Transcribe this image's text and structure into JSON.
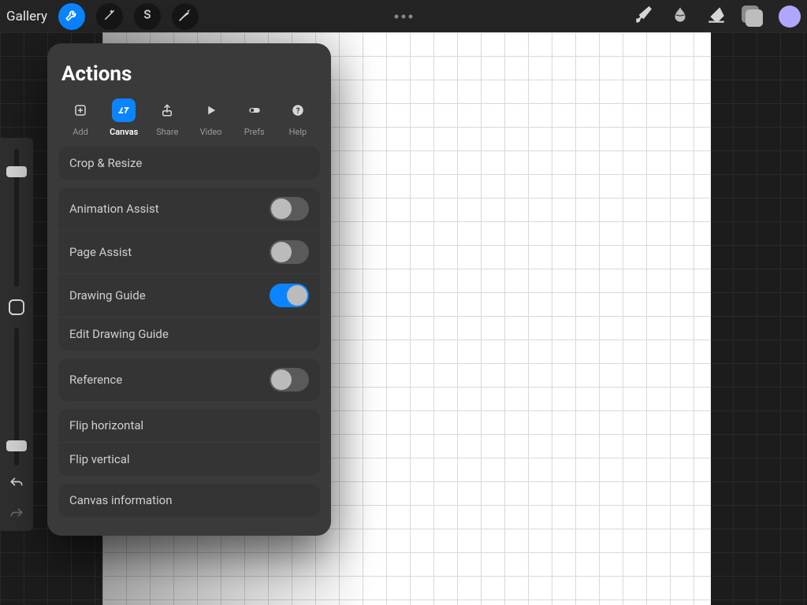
{
  "topbar": {
    "gallery": "Gallery"
  },
  "popover": {
    "title": "Actions",
    "tabs": [
      {
        "label": "Add"
      },
      {
        "label": "Canvas"
      },
      {
        "label": "Share"
      },
      {
        "label": "Video"
      },
      {
        "label": "Prefs"
      },
      {
        "label": "Help"
      }
    ],
    "crop_resize": "Crop & Resize",
    "animation_assist": "Animation Assist",
    "page_assist": "Page Assist",
    "drawing_guide": "Drawing Guide",
    "edit_drawing_guide": "Edit Drawing Guide",
    "reference": "Reference",
    "flip_h": "Flip horizontal",
    "flip_v": "Flip vertical",
    "canvas_info": "Canvas information",
    "toggles": {
      "animation_assist": false,
      "page_assist": false,
      "drawing_guide": true,
      "reference": false
    }
  }
}
